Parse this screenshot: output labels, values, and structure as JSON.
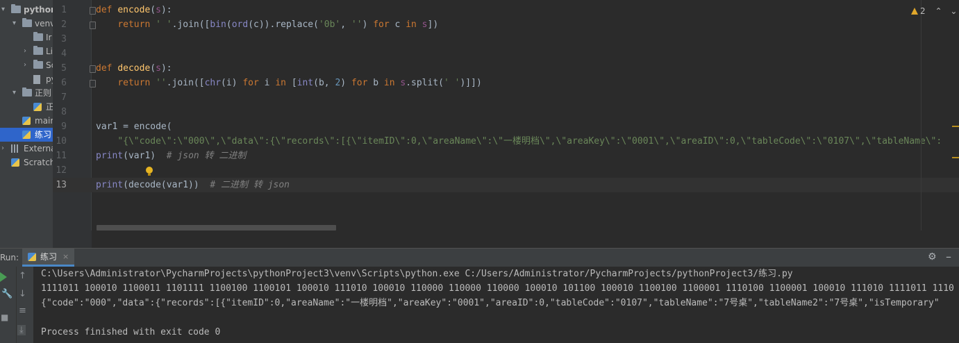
{
  "project_tree": [
    {
      "label": "python",
      "indent": 0,
      "kind": "folder",
      "arrow": "▾"
    },
    {
      "label": "venv",
      "indent": 1,
      "kind": "folder",
      "arrow": "▾"
    },
    {
      "label": "Ir",
      "indent": 2,
      "kind": "folder",
      "arrow": ""
    },
    {
      "label": "Li",
      "indent": 2,
      "kind": "folder",
      "arrow": "›"
    },
    {
      "label": "Sc",
      "indent": 2,
      "kind": "folder",
      "arrow": "›"
    },
    {
      "label": "py",
      "indent": 2,
      "kind": "file",
      "arrow": ""
    },
    {
      "label": "正则",
      "indent": 1,
      "kind": "folder",
      "arrow": "▾"
    },
    {
      "label": "正",
      "indent": 2,
      "kind": "py",
      "arrow": ""
    },
    {
      "label": "main",
      "indent": 1,
      "kind": "py",
      "arrow": ""
    },
    {
      "label": "练习",
      "indent": 1,
      "kind": "py",
      "arrow": "",
      "selected": true
    },
    {
      "label": "External",
      "indent": 0,
      "kind": "lib",
      "arrow": "›"
    },
    {
      "label": "Scratche",
      "indent": 0,
      "kind": "scratch",
      "arrow": ""
    }
  ],
  "editor": {
    "line_numbers": [
      "1",
      "2",
      "3",
      "4",
      "5",
      "6",
      "7",
      "8",
      "9",
      "10",
      "11",
      "12",
      "13"
    ],
    "active_line": "13",
    "inspection_count": "2",
    "lines": [
      [
        [
          "kw",
          "def "
        ],
        [
          "fn",
          "encode"
        ],
        [
          "",
          "("
        ],
        [
          "par",
          "s"
        ],
        [
          "",
          "):"
        ]
      ],
      [
        [
          "",
          "    "
        ],
        [
          "kw",
          "return "
        ],
        [
          "str",
          "' '"
        ],
        [
          "",
          ".join(["
        ],
        [
          "bi",
          "bin"
        ],
        [
          "",
          "("
        ],
        [
          "bi",
          "ord"
        ],
        [
          "",
          "(c)).replace("
        ],
        [
          "str",
          "'0b'"
        ],
        [
          "",
          ", "
        ],
        [
          "str",
          "''"
        ],
        [
          "",
          ") "
        ],
        [
          "kw",
          "for "
        ],
        [
          "",
          "c "
        ],
        [
          "kw",
          "in "
        ],
        [
          "par",
          "s"
        ],
        [
          "",
          "])"
        ]
      ],
      [],
      [],
      [
        [
          "kw",
          "def "
        ],
        [
          "fn",
          "decode"
        ],
        [
          "",
          "("
        ],
        [
          "par",
          "s"
        ],
        [
          "",
          "):"
        ]
      ],
      [
        [
          "",
          "    "
        ],
        [
          "kw",
          "return "
        ],
        [
          "str",
          "''"
        ],
        [
          "",
          ".join(["
        ],
        [
          "bi",
          "chr"
        ],
        [
          "",
          "(i) "
        ],
        [
          "kw",
          "for "
        ],
        [
          "",
          "i "
        ],
        [
          "kw",
          "in "
        ],
        [
          "",
          "["
        ],
        [
          "bi",
          "int"
        ],
        [
          "",
          "(b, "
        ],
        [
          "num",
          "2"
        ],
        [
          "",
          ") "
        ],
        [
          "kw",
          "for "
        ],
        [
          "",
          "b "
        ],
        [
          "kw",
          "in "
        ],
        [
          "par",
          "s"
        ],
        [
          "",
          ".split("
        ],
        [
          "str",
          "' '"
        ],
        [
          "",
          ")]])"
        ]
      ],
      [],
      [],
      [
        [
          "",
          "var1 = encode("
        ]
      ],
      [
        [
          "",
          "    "
        ],
        [
          "str",
          "\"{\\\"code\\\":\\\"000\\\",\\\"data\\\":{\\\"records\\\":[{\\\"itemID\\\":0,\\\"areaName\\\":\\\"一楼明档\\\",\\\"areaKey\\\":\\\"0001\\\",\\\"areaID\\\":0,\\\"tableCode\\\":\\\"0107\\\",\\\"tableName\\\":"
        ]
      ],
      [
        [
          "bi",
          "print"
        ],
        [
          "",
          "(var1)  "
        ],
        [
          "cm",
          "# json 转 二进制"
        ]
      ],
      [],
      [
        [
          "bi",
          "print"
        ],
        [
          "",
          "(decode(var1))  "
        ],
        [
          "cm",
          "# 二进制 转 json"
        ]
      ]
    ]
  },
  "run": {
    "label": "Run:",
    "tab_title": "练习",
    "tab_close": "×",
    "console_lines": [
      "C:\\Users\\Administrator\\PycharmProjects\\pythonProject3\\venv\\Scripts\\python.exe C:/Users/Administrator/PycharmProjects/pythonProject3/练习.py",
      "1111011 100010 1100011 1101111 1100100 1100101 100010 111010 100010 110000 110000 110000 100010 101100 100010 1100100 1100001 1110100 1100001 100010 111010 1111011 1110",
      "{\"code\":\"000\",\"data\":{\"records\":[{\"itemID\":0,\"areaName\":\"一楼明档\",\"areaKey\":\"0001\",\"areaID\":0,\"tableCode\":\"0107\",\"tableName\":\"7号桌\",\"tableName2\":\"7号桌\",\"isTemporary\"",
      "",
      "Process finished with exit code 0"
    ]
  },
  "colors": {
    "keyword": "#cc7832",
    "function": "#ffc66d",
    "string": "#6a8759",
    "number": "#6897bb",
    "builtin": "#8888c6",
    "comment": "#808080",
    "selection": "#2f65ca",
    "warning": "#e0a72b"
  }
}
